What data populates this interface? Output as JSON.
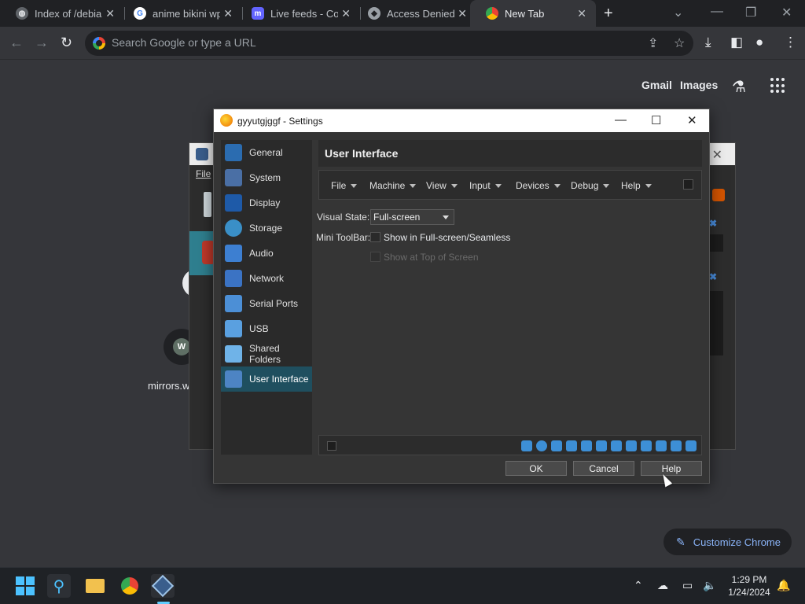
{
  "browser": {
    "tabs": [
      {
        "title": "Index of /debian",
        "favicon": "globe-icon"
      },
      {
        "title": "anime bikini wp",
        "favicon": "google-icon"
      },
      {
        "title": "Live feeds - Con",
        "favicon": "mastodon-icon"
      },
      {
        "title": "Access Denied",
        "favicon": "page-icon"
      },
      {
        "title": "New Tab",
        "favicon": "chrome-icon"
      }
    ],
    "omnibox_placeholder": "Search Google or type a URL",
    "ntp": {
      "gmail": "Gmail",
      "images": "Images",
      "shortcut_letter": "W",
      "shortcut_label": "mirrors.w",
      "customize": "Customize Chrome"
    }
  },
  "vbox_manager": {
    "menu_file": "File"
  },
  "settings_dialog": {
    "title": "gyyutgjggf - Settings",
    "sidebar": [
      {
        "label": "General",
        "color": "#2b6cb0"
      },
      {
        "label": "System",
        "color": "#4a6fa5"
      },
      {
        "label": "Display",
        "color": "#1e5aa8"
      },
      {
        "label": "Storage",
        "color": "#3a8fc7"
      },
      {
        "label": "Audio",
        "color": "#3d7fd1"
      },
      {
        "label": "Network",
        "color": "#3b73c4"
      },
      {
        "label": "Serial Ports",
        "color": "#4c8fd6"
      },
      {
        "label": "USB",
        "color": "#5aa0e0"
      },
      {
        "label": "Shared Folders",
        "color": "#6fb3e8"
      },
      {
        "label": "User Interface",
        "color": "#4d84c4"
      }
    ],
    "selected": "User Interface",
    "page_title": "User Interface",
    "menubar_items": [
      "File",
      "Machine",
      "View",
      "Input",
      "Devices",
      "Debug",
      "Help"
    ],
    "visual_state_label": "Visual State:",
    "visual_state_value": "Full-screen",
    "mini_toolbar_label": "Mini ToolBar:",
    "show_fullscreen": "Show in Full-screen/Seamless",
    "show_top": "Show at Top of Screen",
    "buttons": {
      "ok": "OK",
      "cancel": "Cancel",
      "help": "Help"
    }
  },
  "taskbar": {
    "time": "1:29 PM",
    "date": "1/24/2024"
  }
}
